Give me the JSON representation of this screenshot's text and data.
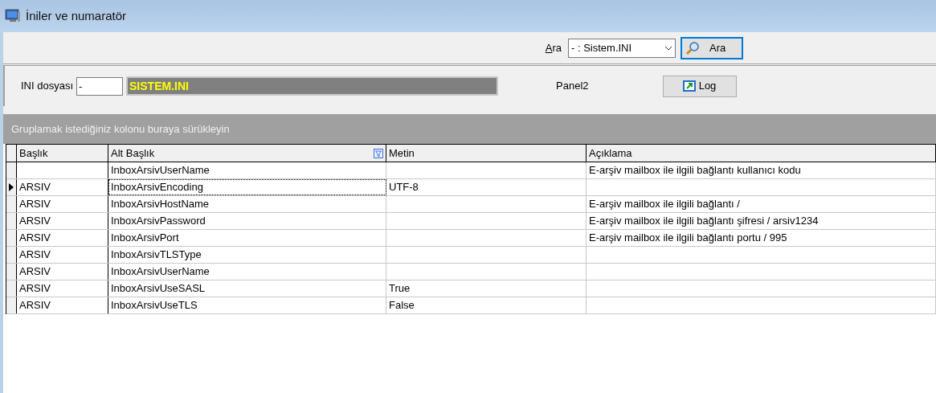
{
  "window": {
    "title": "İniler ve numaratör"
  },
  "search": {
    "label": "Ara",
    "value": "- : Sistem.INI",
    "button": "Ara"
  },
  "ini": {
    "label": "INI dosyası",
    "code": "-",
    "name": "SISTEM.INI"
  },
  "panel_label": "Panel2",
  "log_button": "Log",
  "group_hint": "Gruplamak istediğiniz kolonu buraya sürükleyin",
  "table": {
    "columns": [
      {
        "label": "Başlık",
        "filter": false
      },
      {
        "label": "Alt Başlık",
        "filter": true
      },
      {
        "label": "Metin",
        "filter": false
      },
      {
        "label": "Açıklama",
        "filter": false
      }
    ],
    "rows": [
      {
        "selected": false,
        "cells": [
          "",
          "InboxArsivUserName",
          "",
          "E-arşiv mailbox ile ilgili bağlantı kullanıcı kodu"
        ]
      },
      {
        "selected": true,
        "cells": [
          "ARSIV",
          "InboxArsivEncoding",
          "UTF-8",
          ""
        ]
      },
      {
        "selected": false,
        "cells": [
          "ARSIV",
          "InboxArsivHostName",
          "",
          "E-arşiv mailbox ile ilgili bağlantı /"
        ]
      },
      {
        "selected": false,
        "cells": [
          "ARSIV",
          "InboxArsivPassword",
          "",
          "E-arşiv mailbox ile ilgili bağlantı şifresi / arsiv1234"
        ]
      },
      {
        "selected": false,
        "cells": [
          "ARSIV",
          "InboxArsivPort",
          "",
          "E-arşiv mailbox ile ilgili bağlantı portu / 995"
        ]
      },
      {
        "selected": false,
        "cells": [
          "ARSIV",
          "InboxArsivTLSType",
          "",
          ""
        ]
      },
      {
        "selected": false,
        "cells": [
          "ARSIV",
          "InboxArsivUserName",
          "",
          ""
        ]
      },
      {
        "selected": false,
        "cells": [
          "ARSIV",
          "InboxArsivUseSASL",
          "True",
          ""
        ]
      },
      {
        "selected": false,
        "cells": [
          "ARSIV",
          "InboxArsivUseTLS",
          "False",
          ""
        ]
      }
    ]
  }
}
